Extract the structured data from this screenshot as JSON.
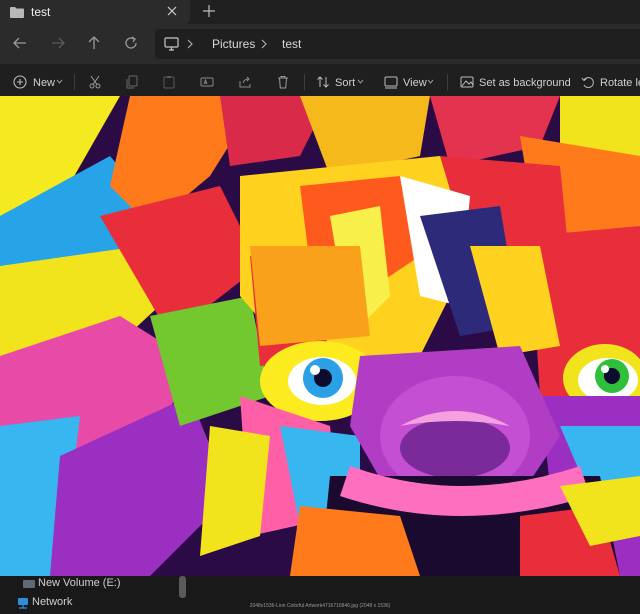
{
  "tab": {
    "title": "test",
    "close_icon": "close-icon",
    "new_tab_icon": "plus-icon"
  },
  "nav": {
    "back_icon": "arrow-left-icon",
    "forward_icon": "arrow-right-icon",
    "up_icon": "arrow-up-icon",
    "refresh_icon": "refresh-icon",
    "breadcrumbs": [
      "Pictures",
      "test"
    ]
  },
  "toolbar": {
    "new_label": "New",
    "sort_label": "Sort",
    "view_label": "View",
    "set_background_label": "Set as background",
    "rotate_left_label": "Rotate left"
  },
  "image": {
    "caption": "2048x1536-Lion Colorful Artwork4716716846.jpg (2048 x 1536)"
  },
  "sidebar": {
    "items": [
      {
        "label": "New Volume (E:)",
        "icon": "drive-icon"
      },
      {
        "label": "Network",
        "icon": "network-icon"
      }
    ]
  },
  "colors": {
    "accent": "#f5c542",
    "background": "#1c1c1c"
  }
}
